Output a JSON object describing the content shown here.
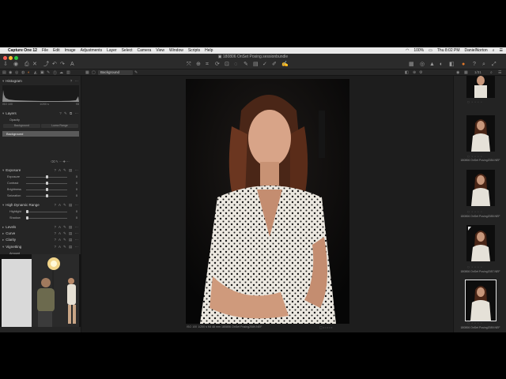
{
  "menubar": {
    "app": "Capture One 12",
    "items": [
      "File",
      "Edit",
      "Image",
      "Adjustments",
      "Layer",
      "Select",
      "Camera",
      "View",
      "Window",
      "Scripts",
      "Help"
    ],
    "battery": "100%",
    "clock": "Thu 8:02 PM",
    "user": "DanielNorton"
  },
  "window": {
    "title": "180806 OnSet Posing.sessionbundle"
  },
  "subbar": {
    "variant": "Background",
    "counter": "1/31"
  },
  "tools": {
    "histogram": {
      "title": "Histogram",
      "iso": "ISO 100",
      "shutter": "1/200 s",
      "aperture": "f/8"
    },
    "layers": {
      "title": "Layers",
      "opacity_label": "Opacity",
      "background_layer": "Background",
      "btn_a": "Background",
      "btn_b": "Luma Range"
    },
    "exposure": {
      "title": "Exposure",
      "sliders": [
        {
          "label": "Exposure",
          "value": "0",
          "level": 0.5
        },
        {
          "label": "Contrast",
          "value": "0",
          "level": 0.5
        },
        {
          "label": "Brightness",
          "value": "0",
          "level": 0.5
        },
        {
          "label": "Saturation",
          "value": "0",
          "level": 0.5
        }
      ]
    },
    "hdr": {
      "title": "High Dynamic Range",
      "sliders": [
        {
          "label": "Highlight",
          "value": "0",
          "level": 0.02
        },
        {
          "label": "Shadow",
          "value": "0",
          "level": 0.02
        }
      ]
    },
    "levels": {
      "title": "Levels"
    },
    "curve": {
      "title": "Curve"
    },
    "clarity": {
      "title": "Clarity"
    },
    "vignetting": {
      "title": "Vignetting",
      "amount_label": "Amount"
    }
  },
  "viewer": {
    "info": {
      "iso": "ISO 100",
      "shutter": "1/200 s",
      "aperture": "f/8",
      "focal": "48 mm",
      "filename": "180806 OnSet Posing2089.NEF"
    }
  },
  "browser": {
    "thumbs": [
      {
        "name": "",
        "selected": false
      },
      {
        "name": "180806 OnSet Posing2084.NEF",
        "selected": false
      },
      {
        "name": "180806 OnSet Posing2085.NEF",
        "selected": false
      },
      {
        "name": "180806 OnSet Posing2087.NEF",
        "selected": false
      },
      {
        "name": "180806 OnSet Posing2089.NEF",
        "selected": true
      }
    ]
  },
  "colors": {
    "accent": "#e0782a",
    "panel": "#252525",
    "viewer_bg": "#1d1d1d"
  }
}
